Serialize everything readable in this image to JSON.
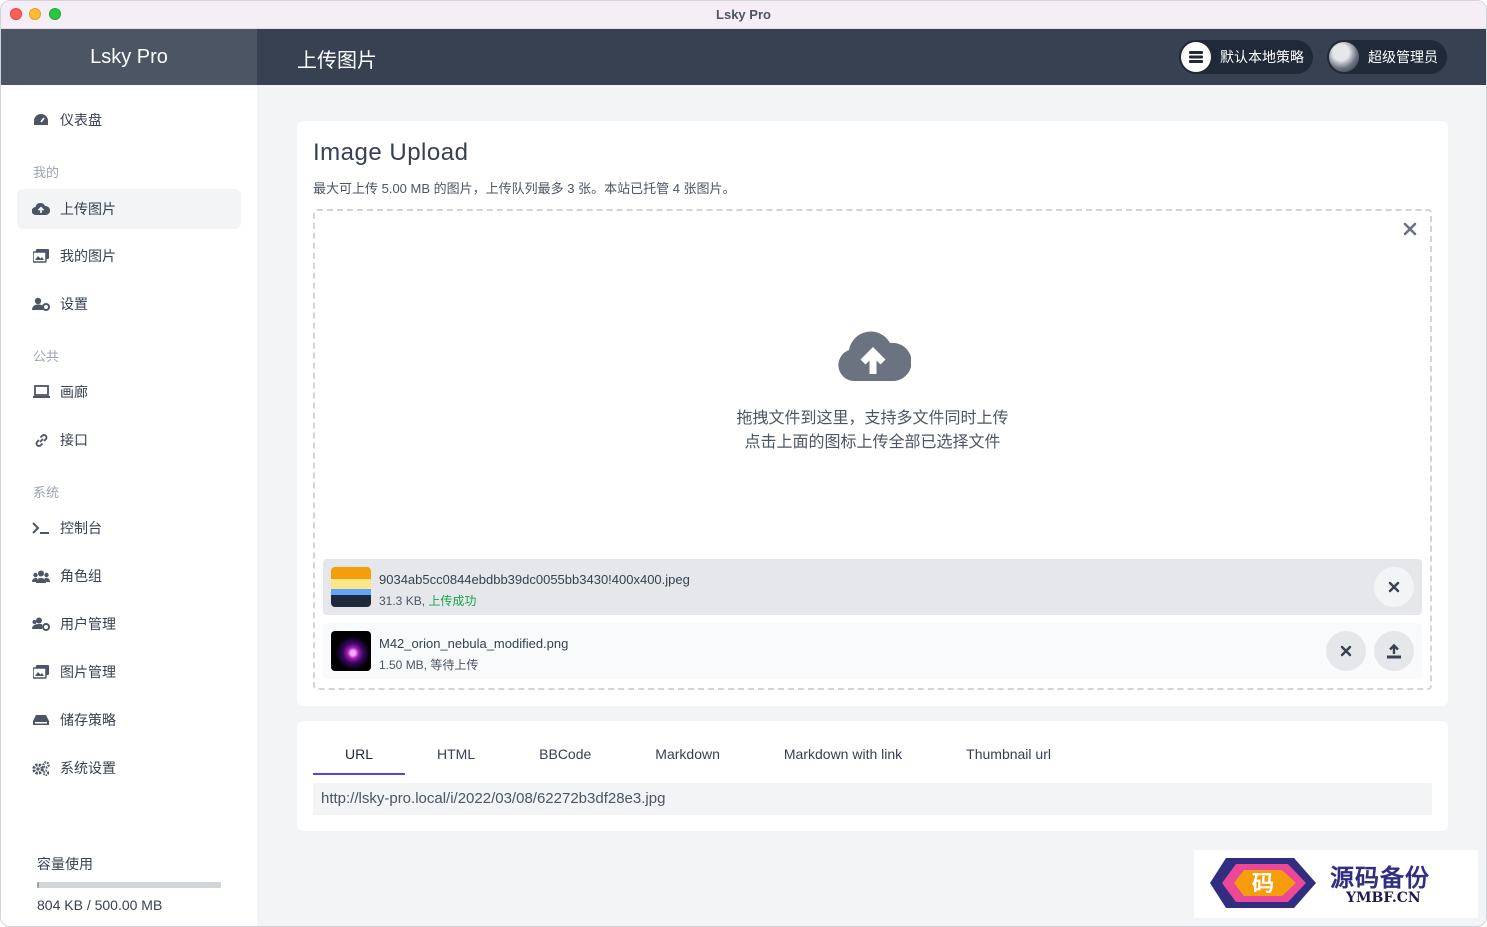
{
  "window": {
    "title": "Lsky Pro"
  },
  "brand": {
    "name": "Lsky Pro"
  },
  "header": {
    "page_title": "上传图片",
    "strategy_label": "默认本地策略",
    "user_label": "超级管理员"
  },
  "sidebar": {
    "dashboard": "仪表盘",
    "section_mine": "我的",
    "upload": "上传图片",
    "my_images": "我的图片",
    "settings": "设置",
    "section_public": "公共",
    "gallery": "画廊",
    "api": "接口",
    "section_system": "系统",
    "console": "控制台",
    "roles": "角色组",
    "users": "用户管理",
    "images": "图片管理",
    "storage": "储存策略",
    "system_settings": "系统设置",
    "usage_title": "容量使用",
    "usage_text": "804 KB / 500.00 MB",
    "usage_fraction": 0.0016
  },
  "upload": {
    "title": "Image Upload",
    "description": "最大可上传 5.00 MB 的图片，上传队列最多 3 张。本站已托管 4 张图片。",
    "drop_line1": "拖拽文件到这里，支持多文件同时上传",
    "drop_line2": "点击上面的图标上传全部已选择文件",
    "files": [
      {
        "name": "9034ab5cc0844ebdbb39dc0055bb3430!400x400.jpeg",
        "size": "31.3 KB, ",
        "status": "上传成功"
      },
      {
        "name": "M42_orion_nebula_modified.png",
        "size": "1.50 MB, ",
        "status": "等待上传"
      }
    ]
  },
  "links": {
    "tabs": [
      "URL",
      "HTML",
      "BBCode",
      "Markdown",
      "Markdown with link",
      "Thumbnail url"
    ],
    "active_tab": "URL",
    "value": "http://lsky-pro.local/i/2022/03/08/62272b3df28e3.jpg"
  },
  "watermark": {
    "text_cn": "源码备份",
    "text_en": "YMBF.CN",
    "badge_char": "码"
  },
  "colors": {
    "accent": "#4f46e5",
    "sidebar_head": "#4b5563",
    "topbar": "#374151",
    "success": "#16a34a"
  }
}
